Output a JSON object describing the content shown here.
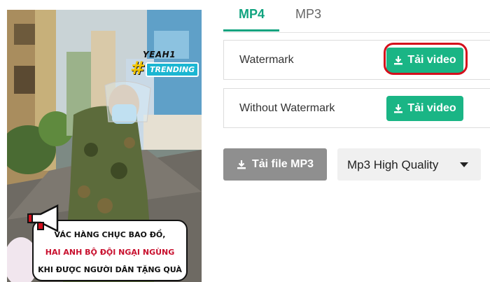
{
  "thumbnail": {
    "logo_top": "YEAH1",
    "logo_hash": "#",
    "logo_badge": "TRENDING",
    "caption_lines": [
      "VÁC HÀNG CHỤC BAO ĐỒ,",
      "HAI ANH BỘ ĐỘI NGẠI NGÙNG",
      "KHI ĐƯỢC NGƯỜI DÂN TẶNG QUÀ"
    ]
  },
  "tabs": [
    {
      "label": "MP4",
      "active": true
    },
    {
      "label": "MP3",
      "active": false
    }
  ],
  "downloads": [
    {
      "label": "Watermark",
      "button": "Tải video",
      "highlighted": true
    },
    {
      "label": "Without Watermark",
      "button": "Tải video",
      "highlighted": false
    }
  ],
  "mp3": {
    "button": "Tải file MP3",
    "quality_selected": "Mp3 High Quality"
  },
  "colors": {
    "accent": "#10a37f",
    "button_green": "#1ab585",
    "highlight_red": "#d40f1c",
    "mp3_gray": "#8f8f8f"
  },
  "icons": {
    "download": "download-icon",
    "dropdown": "caret-down-icon",
    "megaphone": "megaphone-icon"
  }
}
